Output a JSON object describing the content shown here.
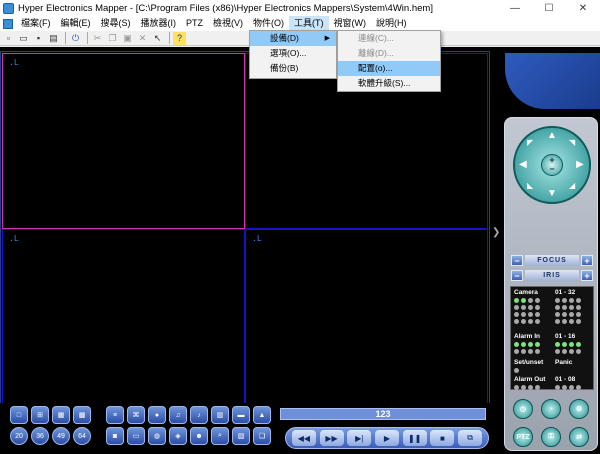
{
  "window": {
    "title": "Hyper Electronics Mapper - [C:\\Program Files (x86)\\Hyper Electronics Mappers\\System\\4Win.hem]",
    "controls": [
      "—",
      "☐",
      "✕"
    ]
  },
  "menubar": {
    "items": [
      "檔案(F)",
      "編輯(E)",
      "搜尋(S)",
      "播放器(I)",
      "PTZ",
      "檢視(V)",
      "物件(O)",
      "工具(T)",
      "視窗(W)",
      "說明(H)"
    ],
    "active_index": 7
  },
  "tools_menu": {
    "items": [
      {
        "label": "設備(D)",
        "has_submenu": true,
        "highlighted": true
      },
      {
        "label": "選項(O)...",
        "has_submenu": false,
        "highlighted": false
      },
      {
        "label": "備份(B)",
        "has_submenu": false,
        "highlighted": false
      }
    ]
  },
  "device_submenu": {
    "items": [
      {
        "label": "連線(C)...",
        "enabled": false,
        "highlighted": false
      },
      {
        "label": "離線(D)...",
        "enabled": false,
        "highlighted": false
      },
      {
        "label": "配置(o)...",
        "enabled": true,
        "highlighted": true
      },
      {
        "label": "軟體升級(S)...",
        "enabled": true,
        "highlighted": false
      }
    ]
  },
  "panes": {
    "labels": [
      ".L",
      ".L",
      ".L",
      ".L"
    ],
    "selected_index": 0
  },
  "playback": {
    "counter": "123",
    "buttons": [
      "◀◀",
      "▶▶",
      "▶|",
      "▶",
      "❚❚",
      "■",
      "⧉"
    ]
  },
  "ptz": {
    "focus_label": "FOCUS",
    "iris_label": "IRIS",
    "minus": "−",
    "plus": "+"
  },
  "status": {
    "camera_label": "Camera",
    "camera_range": "01 - 32",
    "alarm_in_label": "Alarm In",
    "alarm_in_range": "01 - 16",
    "set_unset_label": "Set/unset",
    "panic_label": "Panic",
    "alarm_out_label": "Alarm Out",
    "alarm_out_range": "01 - 08"
  },
  "side_buttons": [
    "PTZ"
  ],
  "colors": {
    "pane_border": "#1515c8",
    "selected_pane_border": "#c83aa6",
    "menu_highlight": "#91c9f7",
    "panel_blue": "#2f5bbf",
    "joystick_teal": "#1e8a8a"
  }
}
